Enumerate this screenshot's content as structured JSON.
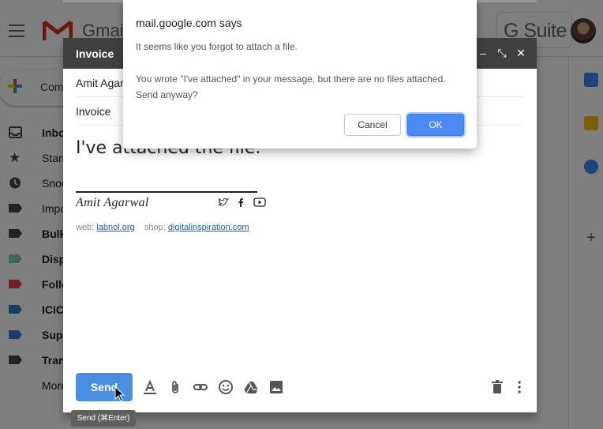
{
  "gmail": {
    "logo_text": "Gmail",
    "gsuite_text": "G Suite",
    "compose_label": "Compose",
    "nav": [
      {
        "label": "Inbox",
        "bold": true,
        "icon": "inbox-icon"
      },
      {
        "label": "Starred",
        "bold": false,
        "icon": "star-icon"
      },
      {
        "label": "Snoozed",
        "bold": false,
        "icon": "clock-icon"
      },
      {
        "label": "Important",
        "bold": false,
        "icon": "important-icon"
      },
      {
        "label": "Bulk",
        "bold": true,
        "icon": "label-icon",
        "color": "#444444"
      },
      {
        "label": "Dispatched",
        "bold": true,
        "icon": "label-icon",
        "color": "#7ccfa6"
      },
      {
        "label": "Follow up",
        "bold": true,
        "icon": "label-icon",
        "color": "#e8453c"
      },
      {
        "label": "ICICI",
        "bold": true,
        "icon": "label-icon",
        "color": "#2a7fd4"
      },
      {
        "label": "Support",
        "bold": true,
        "icon": "label-icon",
        "color": "#2a7fd4"
      },
      {
        "label": "Transactions",
        "bold": true,
        "icon": "label-icon",
        "color": "#444444"
      },
      {
        "label": "More",
        "bold": false,
        "icon": "chevron-down-icon"
      }
    ]
  },
  "compose": {
    "title": "Invoice",
    "to": "Amit Agarwal",
    "subject": "Invoice",
    "body": "I've attached the file.",
    "signature": {
      "name": "Amit Agarwal",
      "web_label": "web:",
      "web_link": "labnol.org",
      "shop_label": "shop:",
      "shop_link": "digitalinspiration.com"
    },
    "send_label": "Send",
    "send_tooltip": "Send (⌘Enter)"
  },
  "dialog": {
    "title": "mail.google.com says",
    "message1": "It seems like you forgot to attach a file.",
    "message2": "You wrote \"I've attached\" in your message, but there are no files attached. Send anyway?",
    "cancel_label": "Cancel",
    "ok_label": "OK"
  },
  "colors": {
    "accent": "#4a8af4",
    "compose_header": "#404040",
    "send_button": "#4a90e2"
  }
}
